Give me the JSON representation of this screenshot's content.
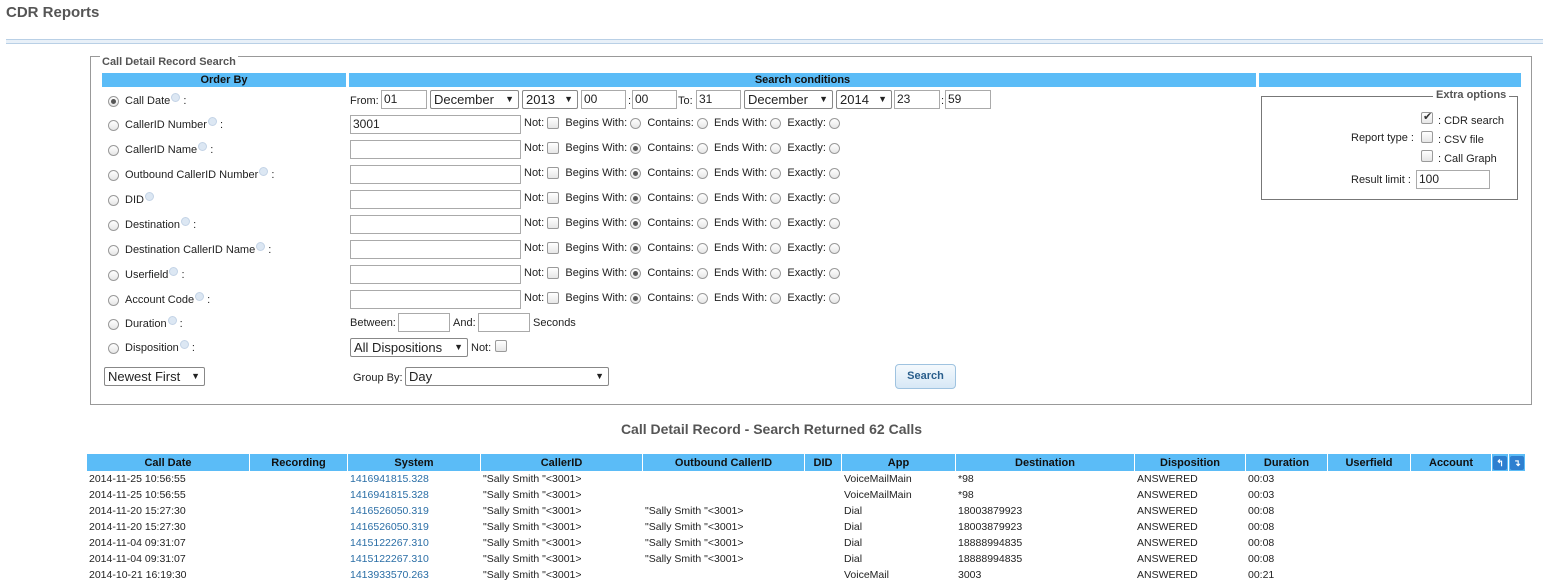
{
  "page_title": "CDR Reports",
  "search_legend": "Call Detail Record Search",
  "headers": {
    "order_by": "Order By",
    "search_conditions": "Search conditions"
  },
  "order_by_items": [
    {
      "label": "Call Date",
      "suffix": ":",
      "selected": true
    },
    {
      "label": "CallerID Number",
      "suffix": ":",
      "selected": false
    },
    {
      "label": "CallerID Name",
      "suffix": ":",
      "selected": false
    },
    {
      "label": "Outbound CallerID Number",
      "suffix": ":",
      "selected": false
    },
    {
      "label": "DID",
      "suffix": "",
      "selected": false
    },
    {
      "label": "Destination",
      "suffix": ":",
      "selected": false
    },
    {
      "label": "Destination CallerID Name",
      "suffix": ":",
      "selected": false
    },
    {
      "label": "Userfield",
      "suffix": ":",
      "selected": false
    },
    {
      "label": "Account Code",
      "suffix": ":",
      "selected": false
    },
    {
      "label": "Duration",
      "suffix": ":",
      "selected": false
    },
    {
      "label": "Disposition",
      "suffix": ":",
      "selected": false
    }
  ],
  "date_range": {
    "from_label": "From:",
    "from_day": "01",
    "from_month": "December",
    "from_year": "2013",
    "from_hour": "00",
    "from_min": "00",
    "to_label": "To:",
    "to_day": "31",
    "to_month": "December",
    "to_year": "2014",
    "to_hour": "23",
    "to_min": "59",
    "colon": ":"
  },
  "text_fields": [
    {
      "value": "3001"
    },
    {
      "value": ""
    },
    {
      "value": ""
    },
    {
      "value": ""
    },
    {
      "value": ""
    },
    {
      "value": ""
    },
    {
      "value": ""
    },
    {
      "value": ""
    }
  ],
  "match_labels": {
    "not": "Not:",
    "begins": "Begins With:",
    "contains": "Contains:",
    "ends": "Ends With:",
    "exactly": "Exactly:"
  },
  "duration": {
    "between": "Between:",
    "and": "And:",
    "seconds": "Seconds"
  },
  "disposition": {
    "selected": "All Dispositions",
    "not": "Not:"
  },
  "sort_order": "Newest First",
  "group_by": {
    "label": "Group By:",
    "selected": "Day"
  },
  "search_button": "Search",
  "extra_options": {
    "legend": "Extra options",
    "report_type_label": "Report type :",
    "cdr_search": ": CDR search",
    "csv_file": ": CSV file",
    "call_graph": ": Call Graph",
    "result_limit_label": "Result limit :",
    "result_limit": "100"
  },
  "results_title": "Call Detail Record - Search Returned 62 Calls",
  "table": {
    "columns": [
      "Call Date",
      "Recording",
      "System",
      "CallerID",
      "Outbound CallerID",
      "DID",
      "App",
      "Destination",
      "Disposition",
      "Duration",
      "Userfield",
      "Account"
    ],
    "rows": [
      [
        "2014-11-25 10:56:55",
        "",
        "1416941815.328",
        "\"Sally Smith \"<3001>",
        "",
        "",
        "VoiceMailMain",
        "*98",
        "ANSWERED",
        "00:03",
        "",
        ""
      ],
      [
        "2014-11-25 10:56:55",
        "",
        "1416941815.328",
        "\"Sally Smith \"<3001>",
        "",
        "",
        "VoiceMailMain",
        "*98",
        "ANSWERED",
        "00:03",
        "",
        ""
      ],
      [
        "2014-11-20 15:27:30",
        "",
        "1416526050.319",
        "\"Sally Smith \"<3001>",
        "\"Sally Smith \"<3001>",
        "",
        "Dial",
        "18003879923",
        "ANSWERED",
        "00:08",
        "",
        ""
      ],
      [
        "2014-11-20 15:27:30",
        "",
        "1416526050.319",
        "\"Sally Smith \"<3001>",
        "\"Sally Smith \"<3001>",
        "",
        "Dial",
        "18003879923",
        "ANSWERED",
        "00:08",
        "",
        ""
      ],
      [
        "2014-11-04 09:31:07",
        "",
        "1415122267.310",
        "\"Sally Smith \"<3001>",
        "\"Sally Smith \"<3001>",
        "",
        "Dial",
        "18888994835",
        "ANSWERED",
        "00:08",
        "",
        ""
      ],
      [
        "2014-11-04 09:31:07",
        "",
        "1415122267.310",
        "\"Sally Smith \"<3001>",
        "\"Sally Smith \"<3001>",
        "",
        "Dial",
        "18888994835",
        "ANSWERED",
        "00:08",
        "",
        ""
      ],
      [
        "2014-10-21 16:19:30",
        "",
        "1413933570.263",
        "\"Sally Smith \"<3001>",
        "",
        "",
        "VoiceMail",
        "3003",
        "ANSWERED",
        "00:21",
        "",
        ""
      ]
    ]
  },
  "colors": {
    "header_blue": "#5bbcf7",
    "link_blue": "#2a6ea6"
  }
}
